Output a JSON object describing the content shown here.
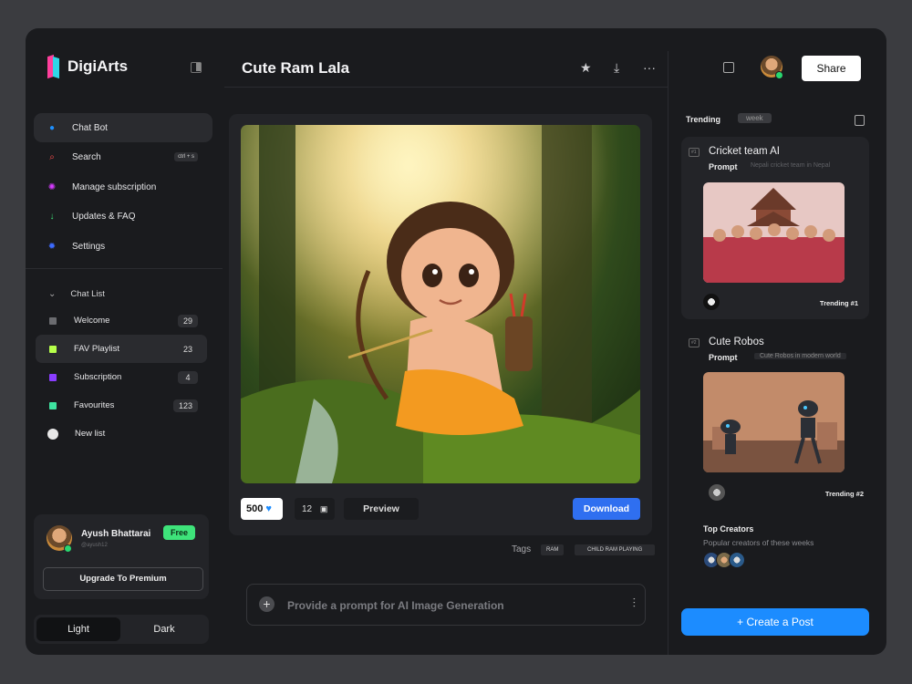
{
  "app": {
    "name": "DigiArts"
  },
  "menu": [
    {
      "label": "Chat Bot",
      "icon": "chat-bot-icon",
      "color": "#1e90ff"
    },
    {
      "label": "Search",
      "icon": "search-icon",
      "color": "#ff4d4d",
      "shortcut": "ctrl + s"
    },
    {
      "label": "Manage subscription",
      "icon": "subscription-icon",
      "color": "#d63cff"
    },
    {
      "label": "Updates & FAQ",
      "icon": "arrow-down-icon",
      "color": "#3ee37a"
    },
    {
      "label": "Settings",
      "icon": "gear-icon",
      "color": "#3d6bff"
    }
  ],
  "chat_list": {
    "header": "Chat List",
    "items": [
      {
        "label": "Welcome",
        "count": "29",
        "color": "#6b6c70"
      },
      {
        "label": "FAV Playlist",
        "count": "23",
        "color": "#b6ff4a"
      },
      {
        "label": "Subscription",
        "count": "4",
        "color": "#8a3dff"
      },
      {
        "label": "Favourites",
        "count": "123",
        "color": "#3ee3a0"
      },
      {
        "label": "New list",
        "count": "",
        "color": "#e8e8e8"
      }
    ]
  },
  "user": {
    "name": "Ayush Bhattarai",
    "handle": "@ayush12",
    "plan": "Free",
    "upgrade_label": "Upgrade To Premium"
  },
  "theme": {
    "light": "Light",
    "dark": "Dark",
    "selected": "Light"
  },
  "main": {
    "title": "Cute Ram Lala",
    "likes": "500",
    "comments": "12",
    "preview_label": "Preview",
    "download_label": "Download",
    "tags_label": "Tags",
    "tags": [
      "RAM",
      "CHILD RAM PLAYING"
    ],
    "prompt_placeholder": "Provide a prompt for AI Image Generation"
  },
  "header": {
    "share_label": "Share"
  },
  "trending": {
    "label": "Trending",
    "period": "week",
    "items": [
      {
        "num": "#1",
        "title": "Cricket team AI",
        "prompt_label": "Prompt",
        "prompt": "Nepali cricket team in Nepal",
        "badge": "Trending #1"
      },
      {
        "num": "#2",
        "title": "Cute Robos",
        "prompt_label": "Prompt",
        "prompt": "Cute Robos in modern world",
        "badge": "Trending #2"
      }
    ]
  },
  "creators": {
    "title": "Top Creators",
    "subtitle": "Popular creators of these weeks"
  },
  "create_post_label": "+ Create a Post",
  "colors": {
    "accent": "#1c8cff",
    "download": "#2f6ff0",
    "free_badge": "#3ee37a",
    "online": "#29d66f"
  }
}
